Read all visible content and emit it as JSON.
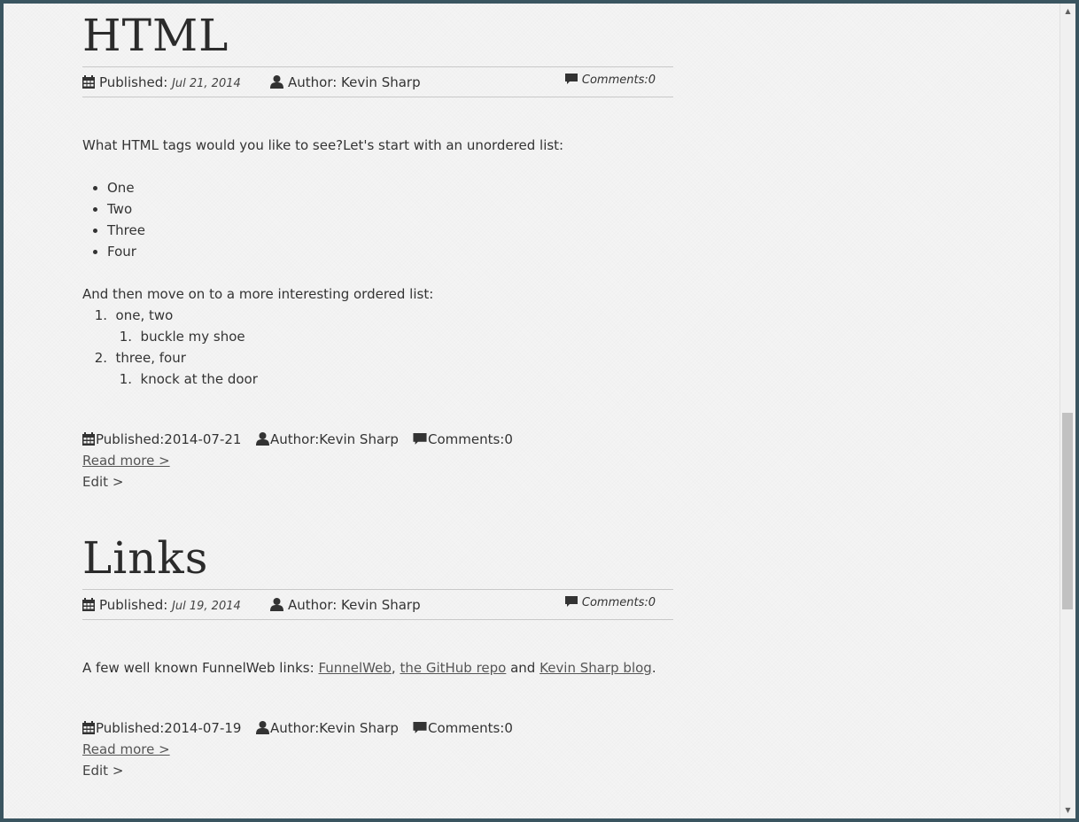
{
  "posts": [
    {
      "title": "HTML",
      "meta": {
        "published_label": "Published:",
        "published_date": "Jul 21, 2014",
        "author_label": "Author: Kevin Sharp",
        "comments": "Comments:0"
      },
      "intro": "What HTML tags would you like to see?Let's start with an unordered list:",
      "unordered": [
        "One",
        "Two",
        "Three",
        "Four"
      ],
      "ordered_intro": "And then move on to a more interesting ordered list:",
      "ordered": [
        {
          "num": "1.",
          "text": "one, two",
          "sub": {
            "num": "1.",
            "text": "buckle my shoe"
          }
        },
        {
          "num": "2.",
          "text": "three, four",
          "sub": {
            "num": "1.",
            "text": "knock at the door"
          }
        }
      ],
      "footer": {
        "published": "Published:2014-07-21",
        "author": "Author:Kevin Sharp",
        "comments": "Comments:0",
        "read_more": "Read more >",
        "edit": "Edit >"
      }
    },
    {
      "title": "Links",
      "meta": {
        "published_label": "Published:",
        "published_date": "Jul 19, 2014",
        "author_label": "Author: Kevin Sharp",
        "comments": "Comments:0"
      },
      "body": {
        "prefix": "A few well known FunnelWeb links: ",
        "link1": "FunnelWeb",
        "sep1": ", ",
        "link2": "the GitHub repo",
        "sep2": " and ",
        "link3": "Kevin Sharp blog",
        "suffix": "."
      },
      "footer": {
        "published": "Published:2014-07-19",
        "author": "Author:Kevin Sharp",
        "comments": "Comments:0",
        "read_more": "Read more >",
        "edit": "Edit >"
      }
    }
  ],
  "icons": {
    "calendar": "calendar-icon",
    "user": "user-icon",
    "comment": "comment-icon"
  },
  "colors": {
    "text": "#333333",
    "background": "#f4f4f4",
    "rule": "#c8c8c8"
  }
}
